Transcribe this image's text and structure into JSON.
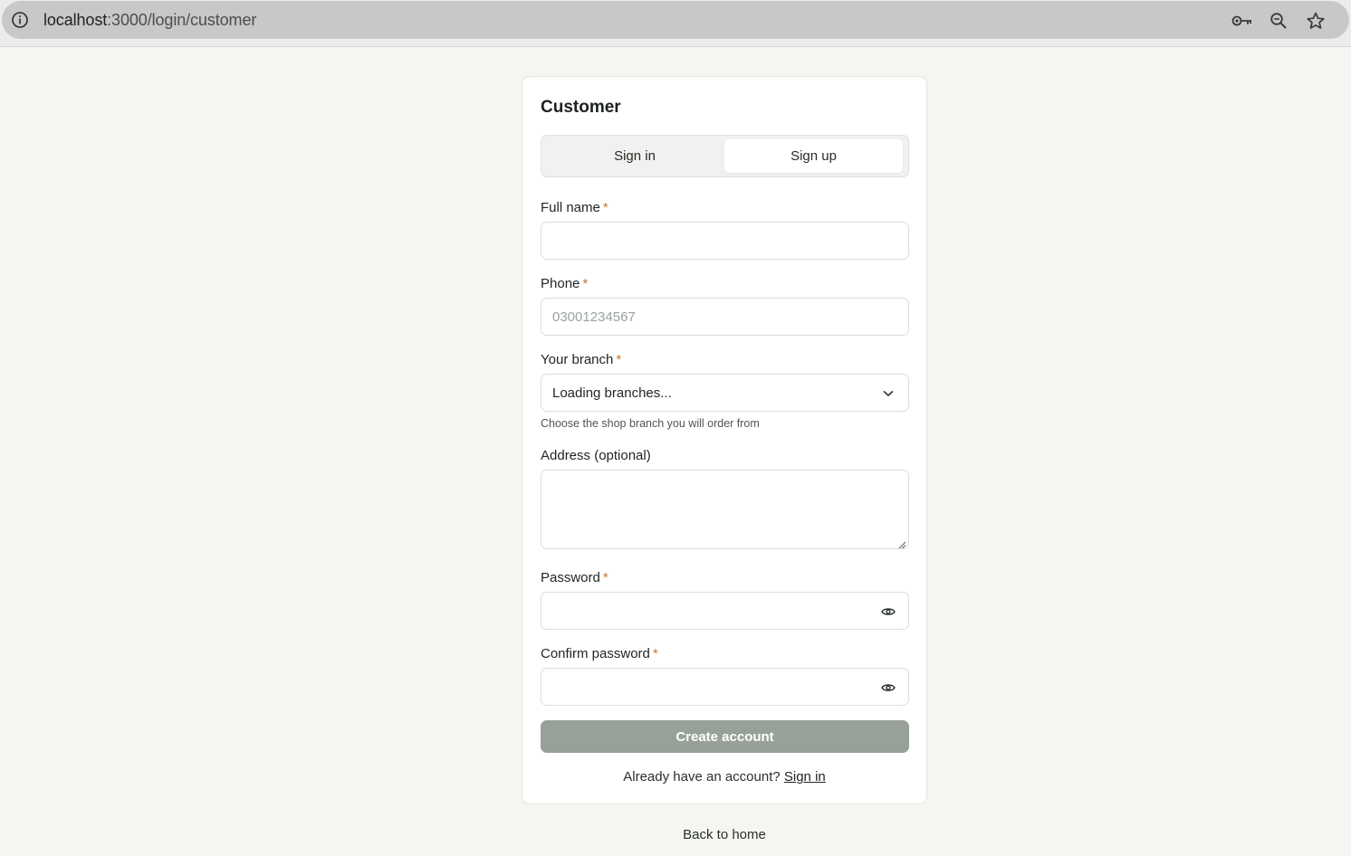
{
  "browser": {
    "url_host": "localhost",
    "url_path": ":3000/login/customer"
  },
  "card": {
    "title": "Customer",
    "tabs": [
      {
        "label": "Sign in",
        "active": false
      },
      {
        "label": "Sign up",
        "active": true
      }
    ]
  },
  "form": {
    "full_name": {
      "label": "Full name",
      "required_mark": "*",
      "value": ""
    },
    "phone": {
      "label": "Phone",
      "required_mark": "*",
      "placeholder": "03001234567"
    },
    "branch": {
      "label": "Your branch",
      "required_mark": "*",
      "selected": "Loading branches...",
      "hint": "Choose the shop branch you will order from"
    },
    "address": {
      "label": "Address (optional)",
      "value": ""
    },
    "password": {
      "label": "Password",
      "required_mark": "*",
      "value": ""
    },
    "confirm_password": {
      "label": "Confirm password",
      "required_mark": "*",
      "value": ""
    },
    "submit_label": "Create account"
  },
  "footer": {
    "prompt": "Already have an account?",
    "link_label": "Sign in"
  },
  "back_home_label": "Back to home",
  "colors": {
    "background": "#f5f6f2",
    "button_disabled": "#97a199",
    "required_mark": "#c5773a"
  }
}
